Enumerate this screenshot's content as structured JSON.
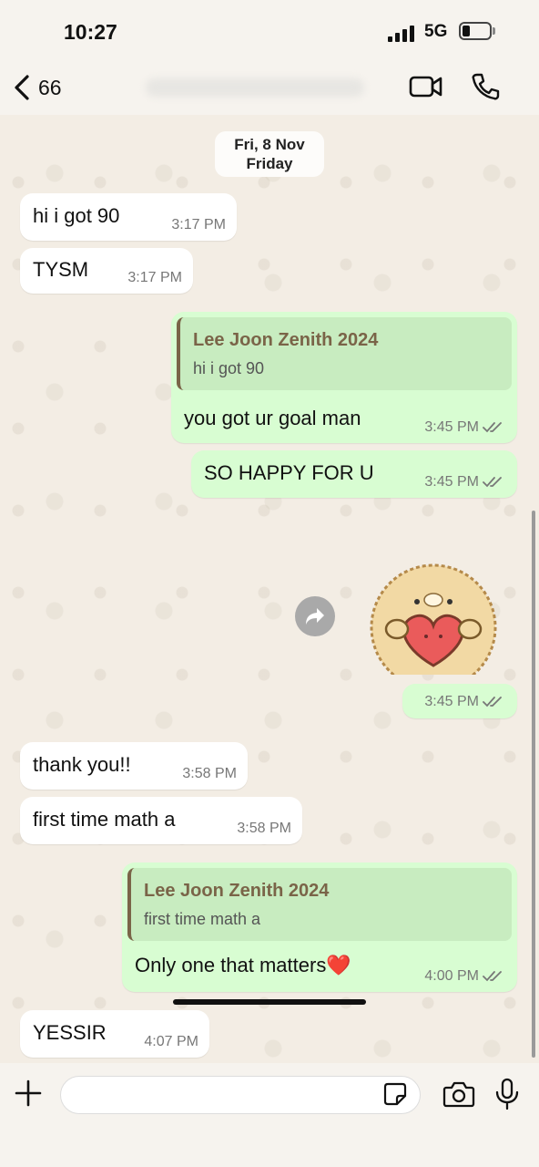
{
  "status_bar": {
    "time": "10:27",
    "network": "5G",
    "battery_level": 0.3
  },
  "header": {
    "back_count": "66"
  },
  "date_divider": {
    "line1": "Fri, 8 Nov",
    "line2": "Friday"
  },
  "messages": [
    {
      "dir": "in",
      "text": "hi i got 90",
      "time": "3:17 PM"
    },
    {
      "dir": "in",
      "text": "TYSM",
      "time": "3:17 PM"
    },
    {
      "dir": "out",
      "quote_name": "Lee Joon Zenith 2024",
      "quote_text": "hi i got 90",
      "text": "you got ur goal man",
      "time": "3:45 PM"
    },
    {
      "dir": "out",
      "text": "SO HAPPY FOR U",
      "time": "3:45 PM"
    },
    {
      "dir": "out",
      "sticker": "hedgehog-holding-heart",
      "time": "3:45 PM"
    },
    {
      "dir": "in",
      "text": "thank you!!",
      "time": "3:58 PM"
    },
    {
      "dir": "in",
      "text": "first time math a",
      "time": "3:58 PM"
    },
    {
      "dir": "out",
      "quote_name": "Lee Joon Zenith 2024",
      "quote_text": "first time math a",
      "text": "Only one that matters❤️",
      "time": "4:00 PM"
    },
    {
      "dir": "in",
      "text": "YESSIR",
      "time": "4:07 PM"
    }
  ],
  "icons": {
    "back": "chevron-left-icon",
    "video": "video-camera-icon",
    "call": "phone-icon",
    "forward": "forward-icon",
    "plus": "plus-icon",
    "sticker": "sticker-icon",
    "camera": "camera-icon",
    "mic": "microphone-icon"
  },
  "colors": {
    "outgoing_bubble": "#d8fdd2",
    "incoming_bubble": "#ffffff",
    "quote_accent": "#7a6448",
    "background": "#f3ede4"
  }
}
